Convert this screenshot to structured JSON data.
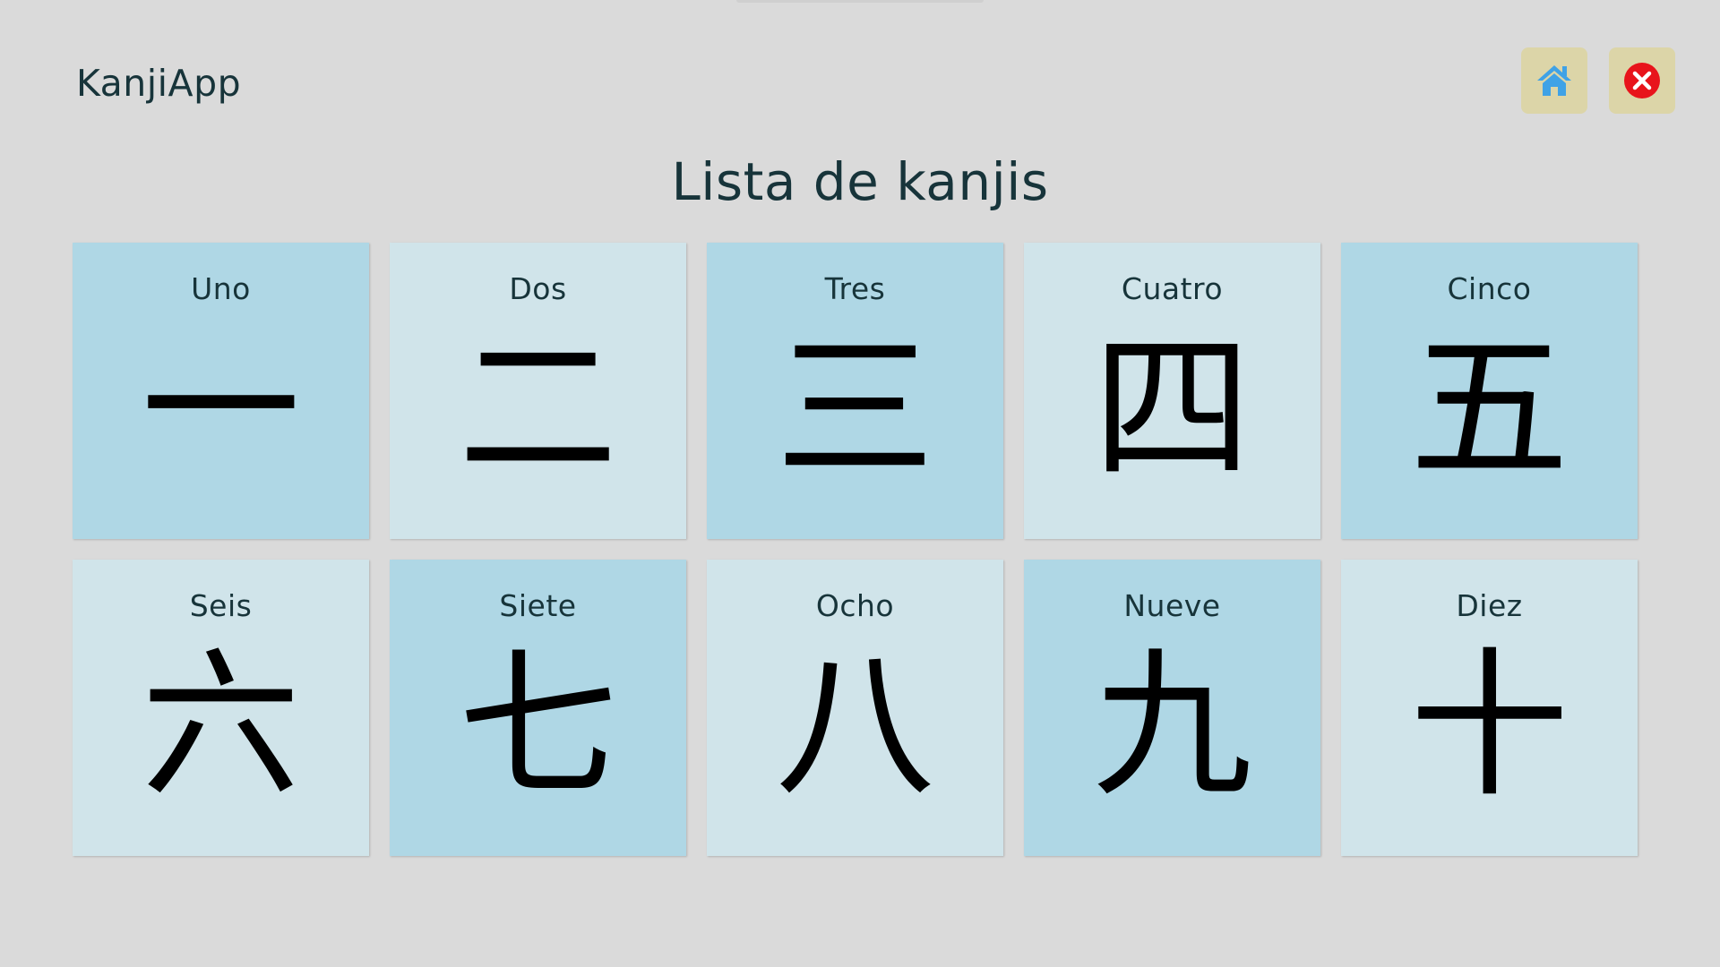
{
  "app": {
    "title": "KanjiApp"
  },
  "header": {
    "home_icon": "home-icon",
    "close_icon": "close-icon",
    "colors": {
      "button_bg": "#dcd5a8",
      "home_icon": "#3fa2e6",
      "close_icon": "#e8141b"
    }
  },
  "main": {
    "title": "Lista de kanjis"
  },
  "kanjis": [
    {
      "label": "Uno",
      "kanji": "一"
    },
    {
      "label": "Dos",
      "kanji": "二"
    },
    {
      "label": "Tres",
      "kanji": "三"
    },
    {
      "label": "Cuatro",
      "kanji": "四"
    },
    {
      "label": "Cinco",
      "kanji": "五"
    },
    {
      "label": "Seis",
      "kanji": "六"
    },
    {
      "label": "Siete",
      "kanji": "七"
    },
    {
      "label": "Ocho",
      "kanji": "八"
    },
    {
      "label": "Nueve",
      "kanji": "九"
    },
    {
      "label": "Diez",
      "kanji": "十"
    }
  ],
  "colors": {
    "background": "#dadada",
    "card_dark": "#afd7e5",
    "card_light": "#d0e4ea",
    "text": "#17343a"
  }
}
